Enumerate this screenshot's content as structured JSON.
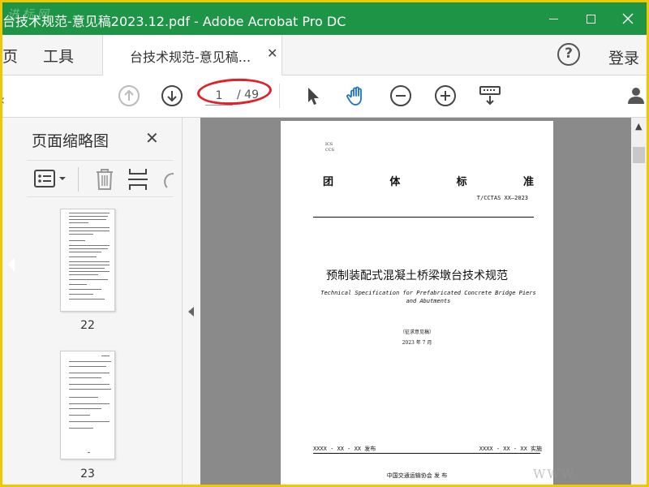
{
  "window": {
    "title": "台技术规范-意见稿2023.12.pdf - Adobe Acrobat Pro DC",
    "watermark_text": "进 标 网"
  },
  "menu": {
    "home": "页",
    "tools": "工具",
    "tab_label": "台技术规范-意见稿...",
    "help": "?",
    "login": "登录"
  },
  "toolbar": {
    "page_current": "1",
    "page_total": "/ 49"
  },
  "panel": {
    "title": "页面缩略图",
    "thumbnails": [
      {
        "page": "22"
      },
      {
        "page": "23"
      }
    ]
  },
  "document": {
    "ics": "ICS",
    "ccs": "CCS",
    "standard_chars": [
      "团",
      "体",
      "标",
      "准"
    ],
    "code": "T/CCTAS XX—2023",
    "title_cn": "预制装配式混凝土桥梁墩台技术规范",
    "title_en": "Technical Specification for Prefabricated Concrete Bridge Piers and Abutments",
    "draft": "（征求意见稿）",
    "date": "2023 年 7 月",
    "issue": "XXXX - XX - XX 发布",
    "implement": "XXXX - XX - XX 实施",
    "org": "中国交通运输协会      发  布"
  },
  "bottom_watermark": "WWW."
}
